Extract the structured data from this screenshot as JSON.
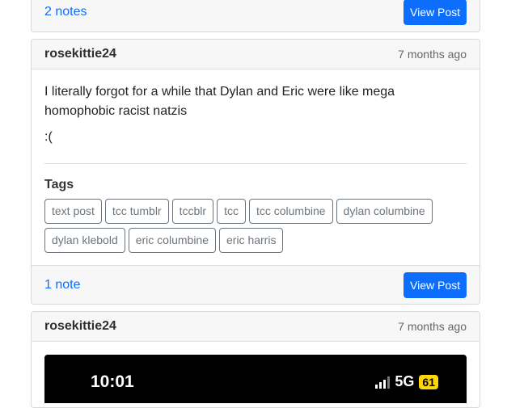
{
  "post_top": {
    "notes": "2 notes",
    "view_button": "View Post"
  },
  "post_main": {
    "username": "rosekittie24",
    "time": "7 months ago",
    "paragraphs": [
      "I literally forgot for a while that Dylan and Eric were like mega homophobic racist natzis",
      ":("
    ],
    "tags_title": "Tags",
    "tags": [
      "text post",
      "tcc tumblr",
      "tccblr",
      "tcc",
      "tcc columbine",
      "dylan columbine",
      "dylan klebold",
      "eric columbine",
      "eric harris"
    ],
    "notes": "1 note",
    "view_button": "View Post"
  },
  "post_bottom": {
    "username": "rosekittie24",
    "time": "7 months ago",
    "image_status": {
      "clock": "10:01",
      "network": "5G",
      "battery": "61"
    }
  },
  "colors": {
    "accent": "#0d6efd",
    "battery": "#ffd60a"
  }
}
